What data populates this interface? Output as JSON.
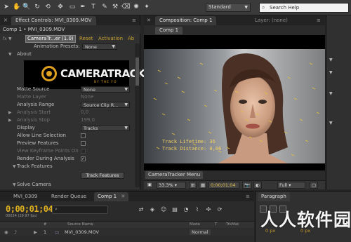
{
  "toolbar": {
    "tools": [
      "arrow-tool-icon",
      "hand-tool-icon",
      "zoom-tool-icon",
      "rotate-tool-icon",
      "orbit-camera-icon",
      "pan-behind-icon",
      "rectangle-tool-icon",
      "pen-tool-icon",
      "text-tool-icon",
      "brush-tool-icon",
      "clone-stamp-icon",
      "eraser-icon",
      "roto-brush-icon",
      "puppet-pin-icon"
    ],
    "workspace": "Standard",
    "search_help": "Search Help"
  },
  "effect_controls": {
    "tab_label": "Effect Controls: MVI_0309.MOV",
    "breadcrumb": "Comp 1 • MVI_0309.MOV",
    "plugin_name": "CameraTr...er (1.0)",
    "reset_link": "Reset",
    "activation_link": "Activation",
    "about_link": "Ab",
    "animation_presets_label": "Animation Presets:",
    "animation_presets_value": "None",
    "about_section": "About",
    "logo_word": "CAMERATRACK",
    "logo_sub": "BY THE FO",
    "rows": [
      {
        "label": "Matte Source",
        "value": "None"
      },
      {
        "label": "Matte Layer",
        "value": "None"
      },
      {
        "label": "Analysis Range",
        "value": "Source Clip R..."
      },
      {
        "label": "Analysis Start",
        "value": "0,0"
      },
      {
        "label": "Analysis Stop",
        "value": "199,0"
      },
      {
        "label": "Display",
        "value": "Tracks"
      },
      {
        "label": "Allow Line Selection",
        "value": ""
      },
      {
        "label": "Preview Features",
        "value": ""
      },
      {
        "label": "View Keyframe Points On",
        "value": ""
      },
      {
        "label": "Render During Analysis",
        "value": "✓"
      },
      {
        "label": "Track Features",
        "value": "Track Features"
      },
      {
        "label": "Solve Camera",
        "value": ""
      }
    ]
  },
  "composition": {
    "tab_label": "Composition: Comp 1",
    "layer_tab": "Layer: (none)",
    "sub_tab": "Comp 1",
    "overlay_line1": "Track Lifetime: 36",
    "overlay_line2": "Track Distance: 0,06",
    "menu_tab": "CameraTracker Menu",
    "zoom": "33.3%",
    "timecode": "0;00;01;04",
    "resolution": "Full"
  },
  "timeline": {
    "tabs": [
      "MVI_0309",
      "Render Queue",
      "Comp 1"
    ],
    "timecode": "0;00;01;04",
    "frame_info": "00034 (29.97 fps)",
    "columns": [
      "#",
      "Source Name",
      "Mode",
      "T",
      "TrkMat"
    ],
    "layer_index": "1",
    "layer_name": "MVI_0309.MOV",
    "layer_mode": "Normal"
  },
  "paragraph": {
    "tab_label": "Paragraph",
    "value1": "0 px",
    "value2": "0 px"
  },
  "watermark": "人人软件园",
  "colors": {
    "accent_gold": "#e0a020",
    "link_gold": "#c9a12e",
    "panel_bg": "#303030"
  }
}
